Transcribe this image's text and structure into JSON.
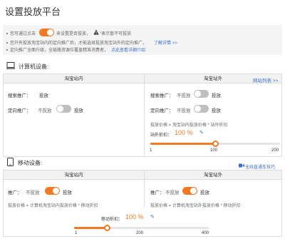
{
  "page": {
    "title": "设置投放平台"
  },
  "info": {
    "line1_prefix": "您可通过点击",
    "line1_mid": "来设置是否投放，",
    "line1_suffix": "\"表示暂不可投放",
    "line2_text": "您只有投放淘宝站内的定向推广后，才能选择投放淘宝站外的定向推广，",
    "line2_link": "了解详情 >>",
    "line3_text": "定向推广全面升级，全链路资源位覆盖精准消费者，",
    "line3_link": "点此查看详细介绍",
    "toggle_on": true
  },
  "pc": {
    "title": "计算机设备:",
    "left_head": "淘宝站内",
    "right_head": "淘宝站外",
    "site_list_link": "网站列表 >>",
    "left_search_label": "搜索推广：",
    "left_search_value": "投放",
    "left_target_label": "定向推广：",
    "left_target_off": "不投放",
    "left_target_on": "投放",
    "right_search_label": "搜索推广：",
    "right_search_off": "不投放",
    "right_search_on": "投放",
    "right_target_label": "定向推广：",
    "right_target_off": "不投放",
    "right_target_on": "投放",
    "formula": "投放价格 = 淘宝站内投放价格 * 站外折扣",
    "discount_label": "站外折扣：",
    "discount_value": "100 %",
    "ticks": [
      "1",
      "100",
      "200"
    ],
    "slider_value": 100,
    "slider_min": 1,
    "slider_max": 200
  },
  "mobile": {
    "title": "移动设备:",
    "tips_link": "无线直通车技巧",
    "left_head": "淘宝站内",
    "right_head": "淘宝站外",
    "left_label": "推广：",
    "left_off": "不投放",
    "left_on": "投放",
    "right_label": "推广：",
    "right_off": "不投放",
    "right_on": "投放",
    "left_formula": "投放价格 = 计算机淘宝站内投放价格 * 移动折扣",
    "right_formula": "投放价格 = 计算机淘宝站外投放价格 * 移动折扣",
    "discount_label": "移动折扣：",
    "discount_value": "100 %",
    "ticks": [
      "1",
      "200",
      "400"
    ],
    "slider_value": 100,
    "slider_min": 1,
    "slider_max": 400
  }
}
